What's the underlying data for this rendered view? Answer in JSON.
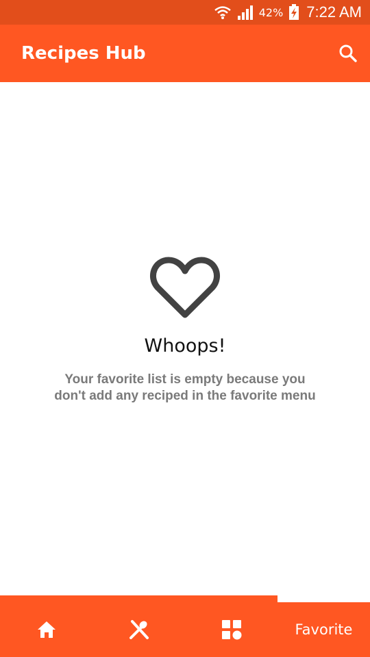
{
  "status_bar": {
    "battery_percent": "42%",
    "time": "7:22 AM"
  },
  "app_bar": {
    "title": "Recipes Hub",
    "search_icon": "search-icon"
  },
  "empty_state": {
    "icon": "heart-outline-icon",
    "title": "Whoops!",
    "message": "Your favorite list is empty because you don't add any reciped in the favorite menu"
  },
  "bottom_nav": {
    "items": [
      {
        "icon": "home-icon"
      },
      {
        "icon": "utensils-icon"
      },
      {
        "icon": "categories-icon"
      },
      {
        "label": "Favorite",
        "active": true
      }
    ]
  },
  "colors": {
    "primary": "#ff5722",
    "status_bar": "#e24e1b",
    "icon_dark": "#424242",
    "text_muted": "#7a7a7a"
  }
}
